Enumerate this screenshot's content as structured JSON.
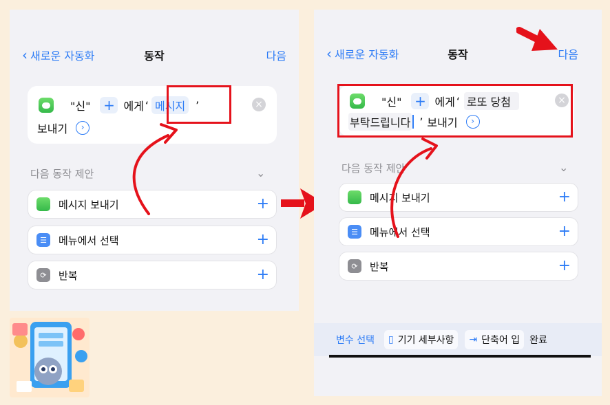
{
  "left": {
    "nav": {
      "back": "새로운 자동화",
      "title": "동작",
      "next": "다음"
    },
    "action": {
      "recipient": "\"신\"",
      "to": "에게",
      "quote_open": "‘",
      "message_placeholder": "메시지",
      "quote_close": "’",
      "send": "보내기"
    },
    "suggestions_header": "다음 동작 제안",
    "suggestions": [
      {
        "label": "메시지 보내기"
      },
      {
        "label": "메뉴에서 선택"
      },
      {
        "label": "반복"
      }
    ]
  },
  "right": {
    "nav": {
      "back": "새로운 자동화",
      "title": "동작",
      "next": "다음"
    },
    "action": {
      "recipient": "\"신\"",
      "to": "에게",
      "quote_open": "‘",
      "message_line1": "로또 당첨",
      "message_line2": "부탁드립니다",
      "quote_close": "’",
      "send": "보내기"
    },
    "suggestions_header": "다음 동작 제안",
    "suggestions": [
      {
        "label": "메시지 보내기"
      },
      {
        "label": "메뉴에서 선택"
      },
      {
        "label": "반복"
      }
    ],
    "toolbar": {
      "variable": "변수 선택",
      "device": "기기 세부사항",
      "shortcut": "단축어 입",
      "done": "완료"
    }
  },
  "colors": {
    "accent": "#2d7cf6",
    "annotation": "#e5121b",
    "background": "#fbefdd"
  }
}
